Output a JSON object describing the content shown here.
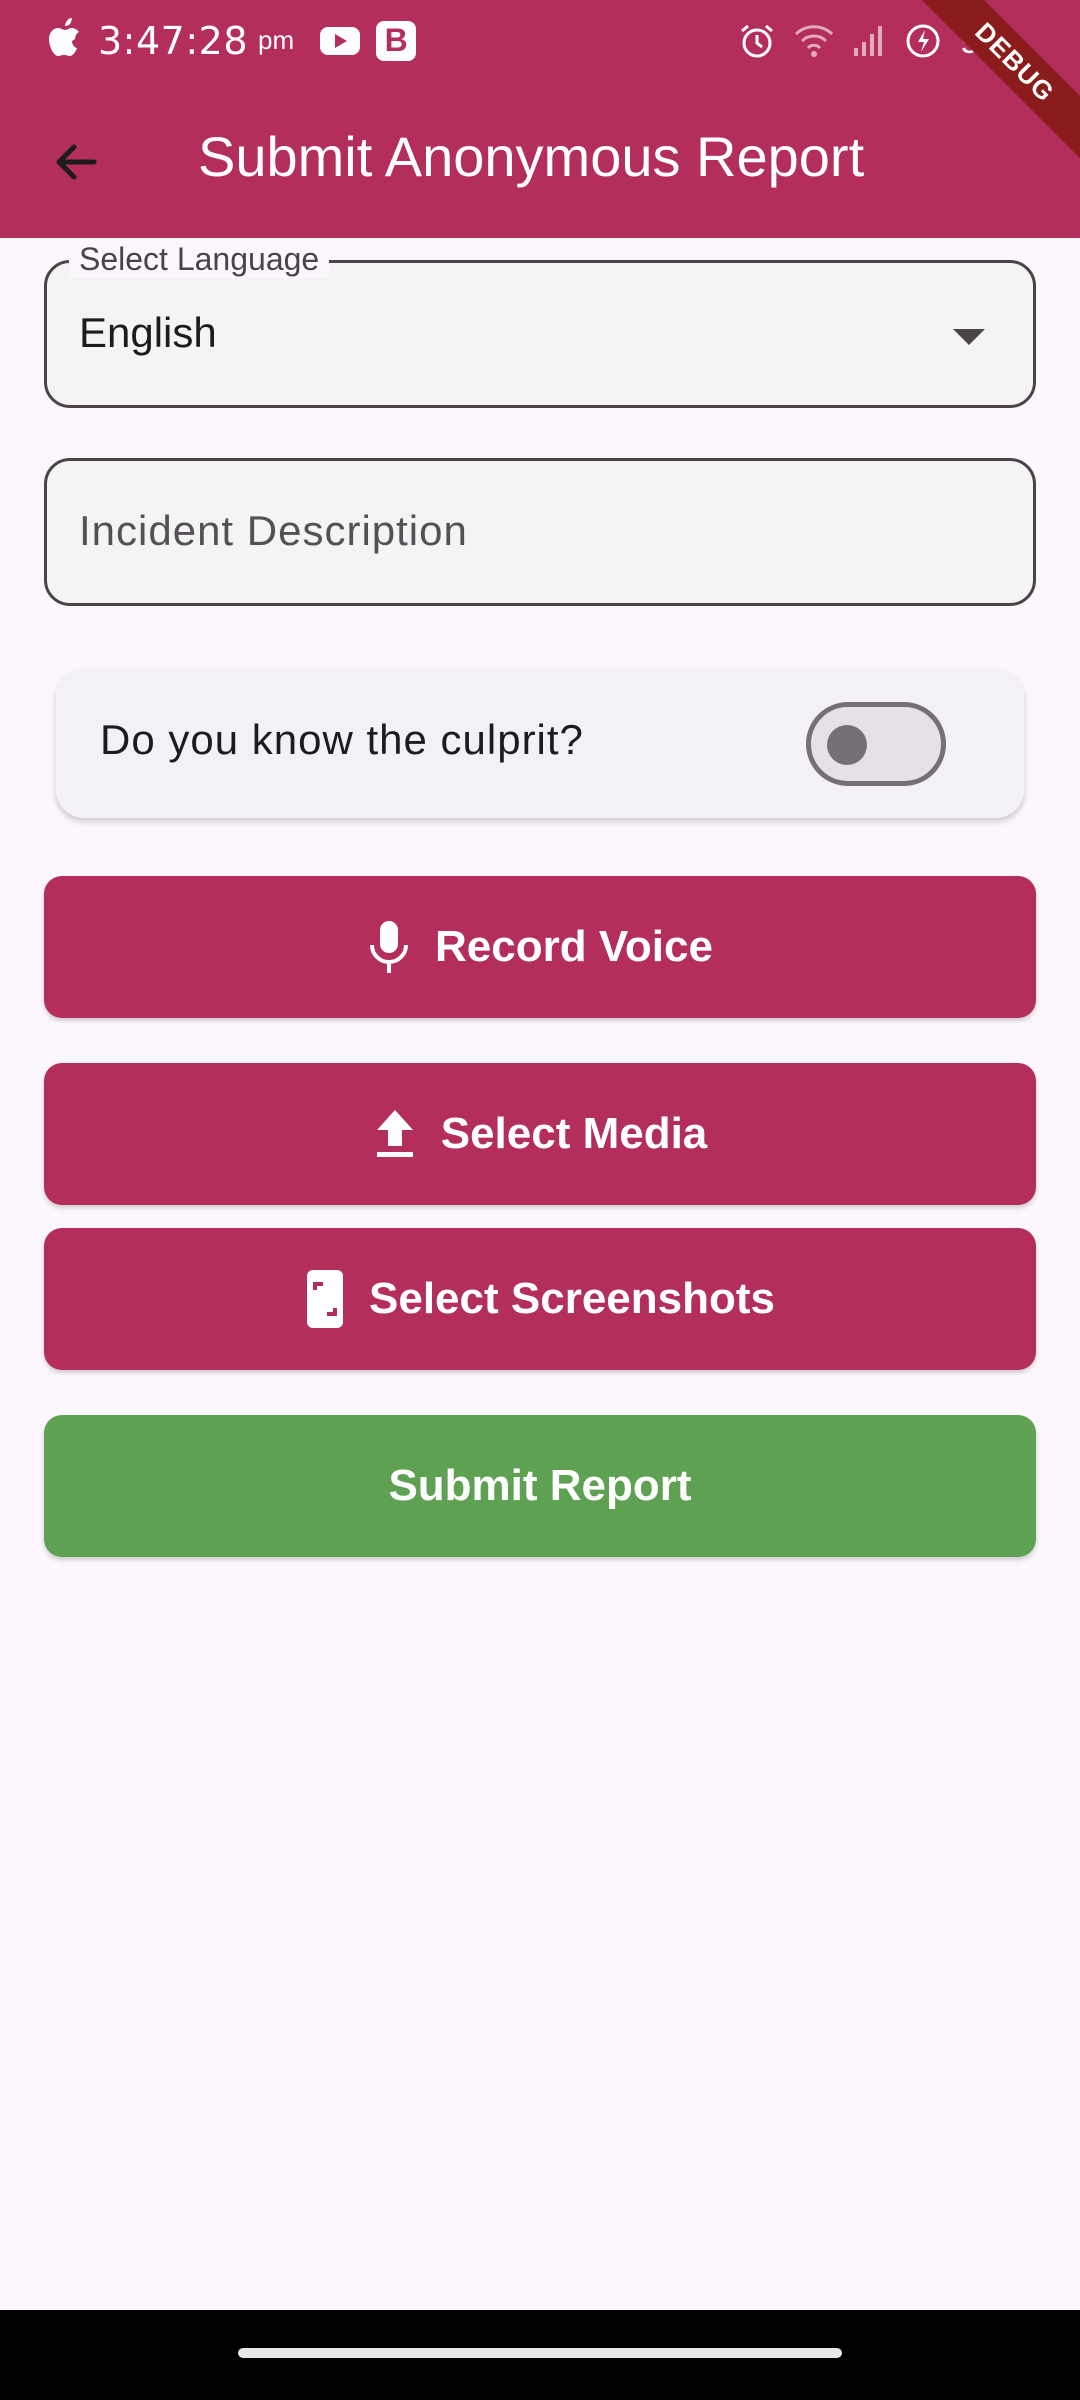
{
  "status_bar": {
    "time": "3:47:28",
    "ampm": "pm",
    "battery": "96",
    "debug_banner": "DEBUG",
    "app_icons": [
      "apple-icon",
      "youtube-icon",
      "b-icon"
    ],
    "system_icons": [
      "alarm-icon",
      "wifi-icon",
      "signal-icon",
      "battery-saver-icon"
    ]
  },
  "app_bar": {
    "title": "Submit Anonymous Report",
    "back_icon": "arrow-back-icon",
    "background": "#b32e5b"
  },
  "form": {
    "language": {
      "label": "Select Language",
      "value": "English"
    },
    "description": {
      "placeholder": "Incident Description"
    },
    "culprit": {
      "label": "Do you know the culprit?",
      "enabled": false
    }
  },
  "actions": {
    "record_voice": "Record Voice",
    "select_media": "Select Media",
    "select_screenshots": "Select Screenshots",
    "submit_report": "Submit Report"
  },
  "colors": {
    "primary": "#b32e5b",
    "submit": "#5ea152",
    "page_background": "#fcf7fc"
  }
}
